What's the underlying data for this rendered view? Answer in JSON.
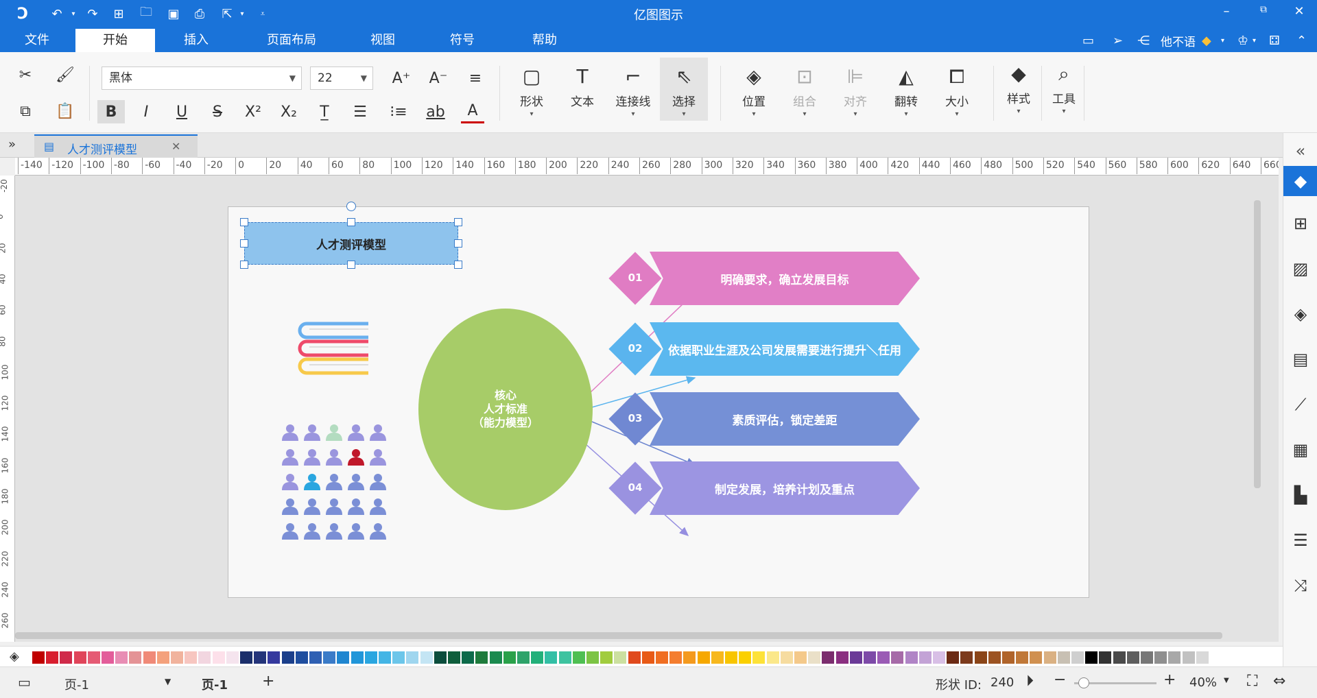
{
  "app": {
    "title": "亿图图示"
  },
  "menu_tabs": [
    "文件",
    "开始",
    "插入",
    "页面布局",
    "视图",
    "符号",
    "帮助"
  ],
  "user": {
    "name": "他不语"
  },
  "font": {
    "family": "黑体",
    "size": "22"
  },
  "ribbon_big": [
    {
      "label": "形状",
      "icon": "rectangle-icon"
    },
    {
      "label": "文本",
      "icon": "text-icon"
    },
    {
      "label": "连接线",
      "icon": "connector-icon"
    },
    {
      "label": "选择",
      "icon": "select-arrow-icon"
    },
    {
      "label": "位置",
      "icon": "layers-icon"
    },
    {
      "label": "组合",
      "icon": "group-icon"
    },
    {
      "label": "对齐",
      "icon": "align-icon"
    },
    {
      "label": "翻转",
      "icon": "flip-icon"
    },
    {
      "label": "大小",
      "icon": "size-icon"
    },
    {
      "label": "样式",
      "icon": "style-bucket-icon"
    },
    {
      "label": "工具",
      "icon": "tools-icon"
    }
  ],
  "document_tab": {
    "title": "人才测评模型"
  },
  "ruler_h": [
    "-140",
    "-120",
    "-100",
    "-80",
    "-60",
    "-40",
    "-20",
    "0",
    "20",
    "40",
    "60",
    "80",
    "100",
    "120",
    "140",
    "160",
    "180",
    "200",
    "220",
    "240",
    "260",
    "280",
    "300",
    "320",
    "340",
    "360",
    "380",
    "400",
    "420",
    "440",
    "460",
    "480",
    "500",
    "520",
    "540",
    "560",
    "580",
    "600",
    "620",
    "640",
    "660"
  ],
  "ruler_v": [
    "-20",
    "0",
    "20",
    "40",
    "60",
    "80",
    "100",
    "120",
    "140",
    "160",
    "180",
    "200",
    "220",
    "240",
    "260"
  ],
  "diagram": {
    "title": "人才测评模型",
    "core_lines": [
      "核心",
      "人才标准",
      "（能力模型）"
    ],
    "steps": [
      {
        "num": "01",
        "text": "明确要求，确立发展目标",
        "color": "#e17fc6",
        "diamond": "#e07cc3"
      },
      {
        "num": "02",
        "text": "依据职业生涯及公司发展需要进行提升＼任用",
        "color": "#5bb8ef",
        "diamond": "#5ab4ee"
      },
      {
        "num": "03",
        "text": "素质评估，锁定差距",
        "color": "#7590d6",
        "diamond": "#7088d2"
      },
      {
        "num": "04",
        "text": "制定发展，培养计划及重点",
        "color": "#9c95e2",
        "diamond": "#9a92e0"
      }
    ],
    "core_color": "#a7cc68"
  },
  "status": {
    "page_select": "页-1",
    "page_tab": "页-1",
    "shape_id_label": "形状 ID:",
    "shape_id": "240",
    "zoom": "40%"
  },
  "palette": [
    "#c00000",
    "#d81e2f",
    "#d02b4a",
    "#e0455a",
    "#e55b74",
    "#e35d9a",
    "#e88db4",
    "#e49396",
    "#f08a78",
    "#f4a17c",
    "#f1b39d",
    "#f7c6c0",
    "#f2d6e0",
    "#fde0ea",
    "#f5e4ee",
    "#1b2f6b",
    "#24347a",
    "#35399e",
    "#1b3f8b",
    "#1f4e9f",
    "#2f60b3",
    "#3a7bc8",
    "#1f86d0",
    "#2196d9",
    "#2aa6e0",
    "#44b5e5",
    "#6cc6ea",
    "#9fd6ef",
    "#c4e5f4",
    "#0b4d3c",
    "#0f5e3c",
    "#0d6b4a",
    "#1e7b3c",
    "#1b8a4f",
    "#2aa14a",
    "#2ea36a",
    "#22b07a",
    "#33bfa5",
    "#3ec3a0",
    "#4fbf52",
    "#7cc444",
    "#a1cc3e",
    "#cce0a0",
    "#e04a1d",
    "#e85a16",
    "#f06e22",
    "#f47d2f",
    "#f49a1e",
    "#f6a800",
    "#f7b81d",
    "#f8c500",
    "#fbd000",
    "#fde238",
    "#fbe88a",
    "#f6dca0",
    "#f4c98a",
    "#eae0c8",
    "#7b2d6e",
    "#8a2f80",
    "#6b3a97",
    "#7d4aa8",
    "#9a5bb5",
    "#a66aa8",
    "#b084c6",
    "#c3a3d6",
    "#d8bfe6",
    "#6b2a14",
    "#7c3a1c",
    "#8b4518",
    "#9c5322",
    "#b0642a",
    "#c07838",
    "#d09050",
    "#dab183",
    "#c8c0b3",
    "#cfcfcf",
    "#000000",
    "#333333",
    "#4a4a4a",
    "#5e5e5e",
    "#777777",
    "#8f8f8f",
    "#a8a8a8",
    "#c1c1c1",
    "#d9d9d9",
    "#ffffff"
  ],
  "people_colors": [
    [
      "#9a95de",
      "#9a95de",
      "#b3dcc0",
      "#9a95de",
      "#9a95de"
    ],
    [
      "#9a95de",
      "#9a95de",
      "#9a95de",
      "#c0182a",
      "#9a95de"
    ],
    [
      "#9a95de",
      "#2aa6e0",
      "#7b8fd6",
      "#7b8fd6",
      "#7b8fd6"
    ],
    [
      "#7b8fd6",
      "#7b8fd6",
      "#7b8fd6",
      "#7b8fd6",
      "#7b8fd6"
    ],
    [
      "#7b8fd6",
      "#7b8fd6",
      "#7b8fd6",
      "#7b8fd6",
      "#7b8fd6"
    ]
  ]
}
